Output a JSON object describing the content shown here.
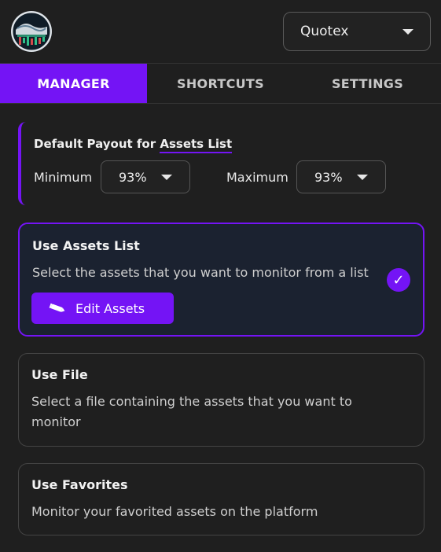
{
  "platform": {
    "selected": "Quotex"
  },
  "tabs": [
    {
      "label": "MANAGER",
      "active": true
    },
    {
      "label": "SHORTCUTS",
      "active": false
    },
    {
      "label": "SETTINGS",
      "active": false
    }
  ],
  "payout": {
    "title_prefix": "Default Payout for",
    "title_link": "Assets List",
    "min_label": "Minimum",
    "min_value": "93%",
    "max_label": "Maximum",
    "max_value": "93%"
  },
  "options": [
    {
      "title": "Use Assets List",
      "desc": "Select the assets that you want to monitor from a list",
      "selected": true,
      "button_label": "Edit Assets",
      "check_glyph": "✓"
    },
    {
      "title": "Use File",
      "desc_line1": "Select a file containing the assets that you want to",
      "desc_line2": "monitor",
      "selected": false
    },
    {
      "title": "Use Favorites",
      "desc": "Monitor your favorited assets on the platform",
      "selected": false
    }
  ],
  "colors": {
    "accent": "#7414f5",
    "background": "#1f1f1f",
    "selected_card": "#1b2230"
  },
  "icons": [
    "app-logo-icon",
    "chevron-down-icon",
    "checkmark-icon",
    "pencil-icon"
  ]
}
